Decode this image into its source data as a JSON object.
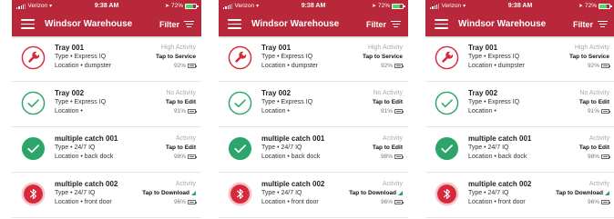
{
  "screens": [
    {
      "status": {
        "carrier": "Verizon",
        "time": "9:38 AM",
        "battery": "72%",
        "battery_level": 0.72
      },
      "header": {
        "title": "Windsor Warehouse",
        "filter_label": "Filter"
      },
      "rows": [
        {
          "icon": "wrench-icon",
          "name": "Tray 001",
          "type": "Type • Express IQ",
          "location": "Location • dumpster",
          "activity": "High Activity",
          "action": "Tap to Service",
          "battery": "92%",
          "battery_level": 0.92,
          "signal": false
        },
        {
          "icon": "check-outline-icon",
          "name": "Tray 002",
          "type": "Type • Express IQ",
          "location": "Location •",
          "activity": "No Activity",
          "action": "Tap to Edit",
          "battery": "91%",
          "battery_level": 0.91,
          "signal": false
        },
        {
          "icon": "check-filled-icon",
          "name": "multiple catch 001",
          "type": "Type • 24/7 IQ",
          "location": "Location • back dock",
          "activity": "Activity",
          "action": "Tap to Edit",
          "battery": "98%",
          "battery_level": 0.98,
          "signal": false
        },
        {
          "icon": "bluetooth-icon",
          "name": "multiple catch 002",
          "type": "Type • 24/7 IQ",
          "location": "Location • front door",
          "activity": "Activity",
          "action": "Tap to Download",
          "battery": "96%",
          "battery_level": 0.96,
          "signal": true
        }
      ]
    },
    {
      "status": {
        "carrier": "Verizon",
        "time": "9:38 AM",
        "battery": "72%",
        "battery_level": 0.72
      },
      "header": {
        "title": "Windsor Warehouse",
        "filter_label": "Filter"
      },
      "rows": [
        {
          "icon": "wrench-icon",
          "name": "Tray 001",
          "type": "Type • Express IQ",
          "location": "Location • dumpster",
          "activity": "High Activity",
          "action": "Tap to Service",
          "battery": "92%",
          "battery_level": 0.92,
          "signal": false
        },
        {
          "icon": "check-outline-icon",
          "name": "Tray 002",
          "type": "Type • Express IQ",
          "location": "Location •",
          "activity": "No Activity",
          "action": "Tap to Edit",
          "battery": "91%",
          "battery_level": 0.91,
          "signal": false
        },
        {
          "icon": "check-filled-icon",
          "name": "multiple catch 001",
          "type": "Type • 24/7 IQ",
          "location": "Location • back dock",
          "activity": "Activity",
          "action": "Tap to Edit",
          "battery": "98%",
          "battery_level": 0.98,
          "signal": false
        },
        {
          "icon": "bluetooth-icon",
          "name": "multiple catch 002",
          "type": "Type • 24/7 IQ",
          "location": "Location • front door",
          "activity": "Activity",
          "action": "Tap to Download",
          "battery": "96%",
          "battery_level": 0.96,
          "signal": true
        }
      ]
    },
    {
      "status": {
        "carrier": "Verizon",
        "time": "9:38 AM",
        "battery": "72%",
        "battery_level": 0.72
      },
      "header": {
        "title": "Windsor Warehouse",
        "filter_label": "Filter"
      },
      "rows": [
        {
          "icon": "wrench-icon",
          "name": "Tray 001",
          "type": "Type • Express IQ",
          "location": "Location • dumpster",
          "activity": "High Activity",
          "action": "Tap to Service",
          "battery": "92%",
          "battery_level": 0.92,
          "signal": false
        },
        {
          "icon": "check-outline-icon",
          "name": "Tray 002",
          "type": "Type • Express IQ",
          "location": "Location •",
          "activity": "No Activity",
          "action": "Tap to Edit",
          "battery": "91%",
          "battery_level": 0.91,
          "signal": false
        },
        {
          "icon": "check-filled-icon",
          "name": "multiple catch 001",
          "type": "Type • 24/7 IQ",
          "location": "Location • back dock",
          "activity": "Activity",
          "action": "Tap to Edit",
          "battery": "98%",
          "battery_level": 0.98,
          "signal": false
        },
        {
          "icon": "bluetooth-icon",
          "name": "multiple catch 002",
          "type": "Type • 24/7 IQ",
          "location": "Location • front door",
          "activity": "Activity",
          "action": "Tap to Download",
          "battery": "96%",
          "battery_level": 0.96,
          "signal": true
        }
      ]
    }
  ],
  "colors": {
    "brand": "#b8283a",
    "alert": "#d8283c",
    "ok": "#2ba56a",
    "muted": "#aaaaaa"
  }
}
